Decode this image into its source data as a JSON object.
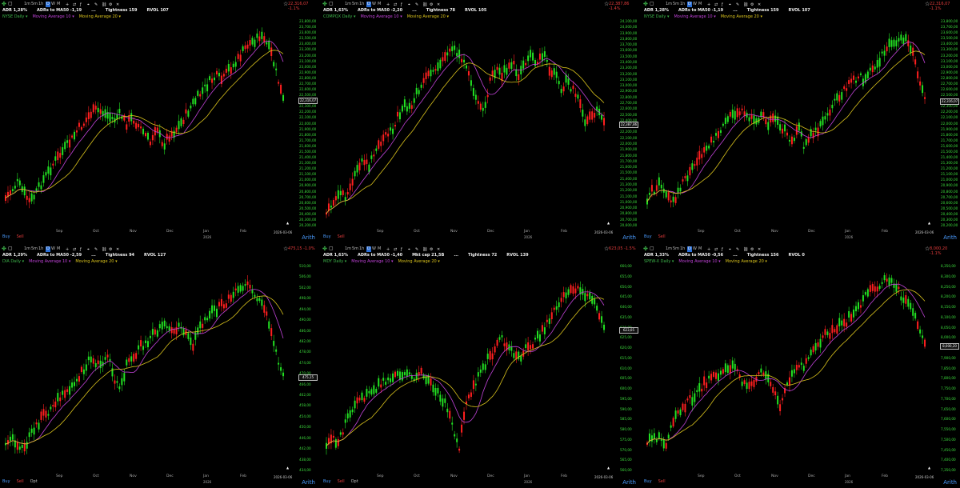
{
  "toolbar": {
    "intervals": [
      "1m",
      "5m",
      "1h",
      "D",
      "W",
      "M"
    ],
    "active_interval": "D",
    "extra_icons": [
      "plus-icon",
      "compare-icon",
      "fx-icon",
      "crosshair-icon",
      "draw-icon",
      "link-icon",
      "settings-icon",
      "close-icon"
    ]
  },
  "months": [
    "Sep",
    "Oct",
    "Nov",
    "Dec",
    "Jan",
    "Feb"
  ],
  "year_label": "2026",
  "colors": {
    "up": "#22e022",
    "down": "#ff1f1f",
    "ma1": "#c042d8",
    "ma2": "#d9c21c",
    "axis": "#3cdc3c",
    "accent": "#2b6fd6"
  },
  "panels": [
    {
      "symbol": "NYSE Daily",
      "ma1": "Moving Average 10",
      "ma2": "Moving Average 20",
      "stats": [
        "ADR 1,28%",
        "ADRs to MA50 -1,19",
        "...",
        "Tightness 159",
        "RVOL 107"
      ],
      "price_badge": "22,316,07 -1.1%",
      "last_price": "22,316,07",
      "date": "2026-03-06",
      "bottom": [
        "Buy",
        "Sell"
      ],
      "scale": "Arith",
      "axis": [
        "23,800,00",
        "23,700,00",
        "23,600,00",
        "23,500,00",
        "23,400,00",
        "23,300,00",
        "23,200,00",
        "23,100,00",
        "23,000,00",
        "22,900,00",
        "22,800,00",
        "22,700,00",
        "22,600,00",
        "22,500,00",
        "22,400,00",
        "22,300,00",
        "22,200,00",
        "22,100,00",
        "22,000,00",
        "21,900,00",
        "21,800,00",
        "21,700,00",
        "21,600,00",
        "21,500,00",
        "21,400,00",
        "21,300,00",
        "21,200,00",
        "21,100,00",
        "21,000,00",
        "20,900,00",
        "20,800,00",
        "20,700,00",
        "20,600,00",
        "20,500,00",
        "20,400,00",
        "20,300,00",
        "20,200,00"
      ],
      "path": [
        0.12,
        0.16,
        0.2,
        0.15,
        0.1,
        0.14,
        0.2,
        0.25,
        0.3,
        0.34,
        0.38,
        0.42,
        0.47,
        0.5,
        0.55,
        0.57,
        0.56,
        0.54,
        0.52,
        0.55,
        0.5,
        0.53,
        0.49,
        0.45,
        0.4,
        0.5,
        0.38,
        0.44,
        0.46,
        0.5,
        0.55,
        0.6,
        0.64,
        0.68,
        0.72,
        0.74,
        0.72,
        0.78,
        0.8,
        0.85,
        0.9,
        0.92,
        0.95,
        0.92,
        0.86,
        0.74,
        0.62
      ]
    },
    {
      "symbol": "COMPQX Daily",
      "ma1": "Moving Average 10",
      "ma2": "Moving Average 20",
      "stats": [
        "ADR 1,63%",
        "ADRs to MA50 -2,20",
        "...",
        "Tightness 78",
        "RVOL 105"
      ],
      "price_badge": "22,387,86 -1.4%",
      "last_price": "22,387,86",
      "date": "2026-03-06",
      "bottom": [
        "Buy",
        "Sell"
      ],
      "scale": "Arith",
      "axis": [
        "24,100,00",
        "24,000,00",
        "23,900,00",
        "23,800,00",
        "23,700,00",
        "23,600,00",
        "23,500,00",
        "23,400,00",
        "23,300,00",
        "23,200,00",
        "23,100,00",
        "23,000,00",
        "22,900,00",
        "22,800,00",
        "22,700,00",
        "22,600,00",
        "22,500,00",
        "22,400,00",
        "22,300,00",
        "22,200,00",
        "22,100,00",
        "22,000,00",
        "21,900,00",
        "21,800,00",
        "21,700,00",
        "21,600,00",
        "21,500,00",
        "21,400,00",
        "21,300,00",
        "21,200,00",
        "21,100,00",
        "21,000,00",
        "20,900,00",
        "20,800,00",
        "20,700,00",
        "20,600,00"
      ],
      "path": [
        0.05,
        0.1,
        0.15,
        0.12,
        0.2,
        0.25,
        0.3,
        0.28,
        0.35,
        0.4,
        0.45,
        0.48,
        0.55,
        0.6,
        0.58,
        0.65,
        0.7,
        0.75,
        0.78,
        0.82,
        0.85,
        0.88,
        0.84,
        0.8,
        0.72,
        0.6,
        0.55,
        0.7,
        0.78,
        0.75,
        0.78,
        0.8,
        0.74,
        0.82,
        0.85,
        0.8,
        0.86,
        0.78,
        0.74,
        0.68,
        0.72,
        0.66,
        0.6,
        0.5,
        0.55,
        0.58,
        0.52
      ]
    },
    {
      "symbol": "NYSE Daily",
      "ma1": "Moving Average 10",
      "ma2": "Moving Average 20",
      "stats": [
        "ADR 1,28%",
        "ADRs to MA50 -1,19",
        "...",
        "Tightness 159",
        "RVOL 107"
      ],
      "price_badge": "22,316,07 -1.1%",
      "last_price": "22,316,07",
      "date": "2026-03-06",
      "bottom": [
        "Buy",
        "Sell"
      ],
      "scale": "Arith",
      "axis": [
        "23,800,00",
        "23,700,00",
        "23,600,00",
        "23,500,00",
        "23,400,00",
        "23,300,00",
        "23,200,00",
        "23,100,00",
        "23,000,00",
        "22,900,00",
        "22,800,00",
        "22,700,00",
        "22,600,00",
        "22,500,00",
        "22,400,00",
        "22,300,00",
        "22,200,00",
        "22,100,00",
        "22,000,00",
        "21,900,00",
        "21,800,00",
        "21,700,00",
        "21,600,00",
        "21,500,00",
        "21,400,00",
        "21,300,00",
        "21,200,00",
        "21,100,00",
        "21,000,00",
        "20,900,00",
        "20,800,00",
        "20,700,00",
        "20,600,00",
        "20,500,00",
        "20,400,00",
        "20,300,00",
        "20,200,00"
      ],
      "path": [
        0.12,
        0.16,
        0.2,
        0.15,
        0.1,
        0.14,
        0.2,
        0.25,
        0.3,
        0.34,
        0.38,
        0.42,
        0.47,
        0.5,
        0.55,
        0.57,
        0.56,
        0.54,
        0.52,
        0.55,
        0.5,
        0.53,
        0.49,
        0.45,
        0.4,
        0.5,
        0.38,
        0.44,
        0.46,
        0.5,
        0.55,
        0.6,
        0.64,
        0.68,
        0.72,
        0.74,
        0.72,
        0.78,
        0.8,
        0.85,
        0.9,
        0.92,
        0.95,
        0.92,
        0.86,
        0.74,
        0.62
      ]
    },
    {
      "symbol": "DIA Daily",
      "ma1": "Moving Average 10",
      "ma2": "Moving Average 20",
      "stats": [
        "ADR 1,29%",
        "ADRs to MA50 -2,59",
        "...",
        "Tightness 94",
        "RVOL 127"
      ],
      "price_badge": "475,15 -1.0%",
      "last_price": "475,15",
      "date": "2026-03-06",
      "bottom": [
        "Buy",
        "Sell",
        "Opt"
      ],
      "scale": "Arith",
      "axis": [
        "510,00",
        "506,00",
        "502,00",
        "498,00",
        "494,00",
        "490,00",
        "486,00",
        "482,00",
        "478,00",
        "474,00",
        "470,00",
        "466,00",
        "462,00",
        "458,00",
        "454,00",
        "450,00",
        "446,00",
        "442,00",
        "438,00",
        "434,00"
      ],
      "path": [
        0.1,
        0.14,
        0.12,
        0.08,
        0.15,
        0.2,
        0.25,
        0.28,
        0.32,
        0.35,
        0.38,
        0.42,
        0.45,
        0.5,
        0.55,
        0.52,
        0.5,
        0.58,
        0.45,
        0.38,
        0.52,
        0.55,
        0.6,
        0.62,
        0.66,
        0.68,
        0.72,
        0.7,
        0.68,
        0.72,
        0.66,
        0.62,
        0.7,
        0.75,
        0.78,
        0.8,
        0.82,
        0.85,
        0.88,
        0.9,
        0.92,
        0.88,
        0.84,
        0.8,
        0.7,
        0.55,
        0.48
      ]
    },
    {
      "symbol": "MDY Daily",
      "ma1": "Moving Average 10",
      "ma2": "Moving Average 20",
      "stats": [
        "ADR 1,63%",
        "ADRs to MA50 -1,40",
        "Mkt cap 21,5B",
        "...",
        "Tightness 72",
        "RVOL 139"
      ],
      "price_badge": "623,05 -1.5%",
      "last_price": "623,05",
      "date": "2026-03-06",
      "bottom": [
        "Buy",
        "Sell",
        "Opt"
      ],
      "scale": "Arith",
      "axis": [
        "660,00",
        "655,00",
        "650,00",
        "645,00",
        "640,00",
        "635,00",
        "630,00",
        "625,00",
        "620,00",
        "615,00",
        "610,00",
        "605,00",
        "600,00",
        "595,00",
        "590,00",
        "585,00",
        "580,00",
        "575,00",
        "570,00",
        "565,00",
        "560,00"
      ],
      "path": [
        0.1,
        0.15,
        0.12,
        0.2,
        0.28,
        0.32,
        0.35,
        0.38,
        0.4,
        0.42,
        0.44,
        0.45,
        0.47,
        0.48,
        0.45,
        0.46,
        0.47,
        0.44,
        0.4,
        0.36,
        0.3,
        0.2,
        0.1,
        0.3,
        0.38,
        0.44,
        0.5,
        0.56,
        0.6,
        0.65,
        0.62,
        0.58,
        0.55,
        0.6,
        0.62,
        0.66,
        0.7,
        0.75,
        0.8,
        0.85,
        0.9,
        0.92,
        0.9,
        0.88,
        0.84,
        0.8,
        0.7
      ]
    },
    {
      "symbol": "SPEW-X Daily",
      "ma1": "Moving Average 10",
      "ma2": "Moving Average 20",
      "stats": [
        "ADR 1,33%",
        "ADRs to MA50 -0,56",
        "...",
        "Tightness 156",
        "RVOL 0"
      ],
      "price_badge": "8,000,20 -1.1%",
      "last_price": "8,000,20",
      "date": "2026-03-06",
      "bottom": [
        "Buy",
        "Sell"
      ],
      "scale": "Arith",
      "axis": [
        "8,350,00",
        "8,300,00",
        "8,250,00",
        "8,200,00",
        "8,150,00",
        "8,100,00",
        "8,050,00",
        "8,000,00",
        "7,950,00",
        "7,900,00",
        "7,850,00",
        "7,800,00",
        "7,750,00",
        "7,700,00",
        "7,650,00",
        "7,600,00",
        "7,550,00",
        "7,500,00",
        "7,450,00",
        "7,400,00",
        "7,350,00"
      ],
      "path": [
        0.12,
        0.16,
        0.14,
        0.1,
        0.2,
        0.26,
        0.3,
        0.34,
        0.36,
        0.4,
        0.44,
        0.46,
        0.48,
        0.5,
        0.52,
        0.48,
        0.42,
        0.4,
        0.46,
        0.5,
        0.44,
        0.38,
        0.3,
        0.4,
        0.46,
        0.5,
        0.52,
        0.58,
        0.62,
        0.66,
        0.68,
        0.7,
        0.72,
        0.74,
        0.78,
        0.82,
        0.86,
        0.9,
        0.92,
        0.94,
        0.95,
        0.92,
        0.88,
        0.84,
        0.8,
        0.72,
        0.64
      ]
    }
  ]
}
